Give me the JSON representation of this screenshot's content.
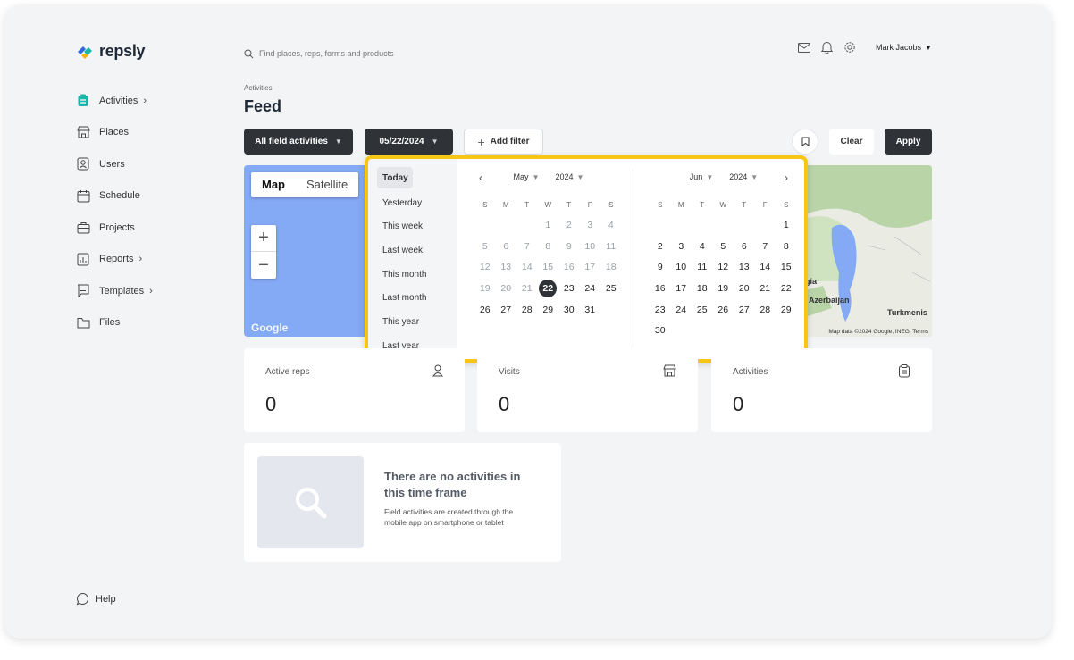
{
  "app": {
    "logo_text": "repsly"
  },
  "search": {
    "placeholder": "Find places, reps, forms and products"
  },
  "user": {
    "name": "Mark Jacobs"
  },
  "sidebar": {
    "items": [
      {
        "label": "Activities",
        "icon": "clipboard-icon",
        "has_chevron": true,
        "active": true
      },
      {
        "label": "Places",
        "icon": "store-icon"
      },
      {
        "label": "Users",
        "icon": "user-badge-icon"
      },
      {
        "label": "Schedule",
        "icon": "calendar-icon"
      },
      {
        "label": "Projects",
        "icon": "briefcase-icon"
      },
      {
        "label": "Reports",
        "icon": "chart-icon",
        "has_chevron": true
      },
      {
        "label": "Templates",
        "icon": "template-icon",
        "has_chevron": true
      },
      {
        "label": "Files",
        "icon": "folder-icon"
      }
    ],
    "help": "Help"
  },
  "header": {
    "breadcrumb": "Activities",
    "title": "Feed"
  },
  "filters": {
    "activity_type": "All field activities",
    "date": "05/22/2024",
    "add_filter": "Add filter",
    "clear": "Clear",
    "apply": "Apply"
  },
  "map": {
    "tab_map": "Map",
    "tab_satellite": "Satellite",
    "zoom_in": "+",
    "zoom_out": "−",
    "google": "Google",
    "attribution": "Map data ©2024 Google, INEGI   Terms",
    "label_georgia": "gia",
    "label_azerbaijan": "Azerbaijan",
    "label_turkmen": "Turkmenis"
  },
  "datepicker": {
    "presets": [
      "Today",
      "Yesterday",
      "This week",
      "Last week",
      "This month",
      "Last month",
      "This year",
      "Last year"
    ],
    "active_preset": "Today",
    "weekdays": [
      "S",
      "M",
      "T",
      "W",
      "T",
      "F",
      "S"
    ],
    "left": {
      "month": "May",
      "year": "2024"
    },
    "right": {
      "month": "Jun",
      "year": "2024"
    },
    "selected_day": "22"
  },
  "stats": [
    {
      "label": "Active reps",
      "value": "0",
      "icon": "person-icon"
    },
    {
      "label": "Visits",
      "value": "0",
      "icon": "store-icon"
    },
    {
      "label": "Activities",
      "value": "0",
      "icon": "clipboard-icon"
    }
  ],
  "empty_state": {
    "title": "There are no activities in this time frame",
    "description": "Field activities are created through the mobile app on smartphone or tablet"
  },
  "colors": {
    "accent_dark": "#2f3237",
    "highlight": "#f7c515",
    "map_water": "#84a9f5"
  }
}
